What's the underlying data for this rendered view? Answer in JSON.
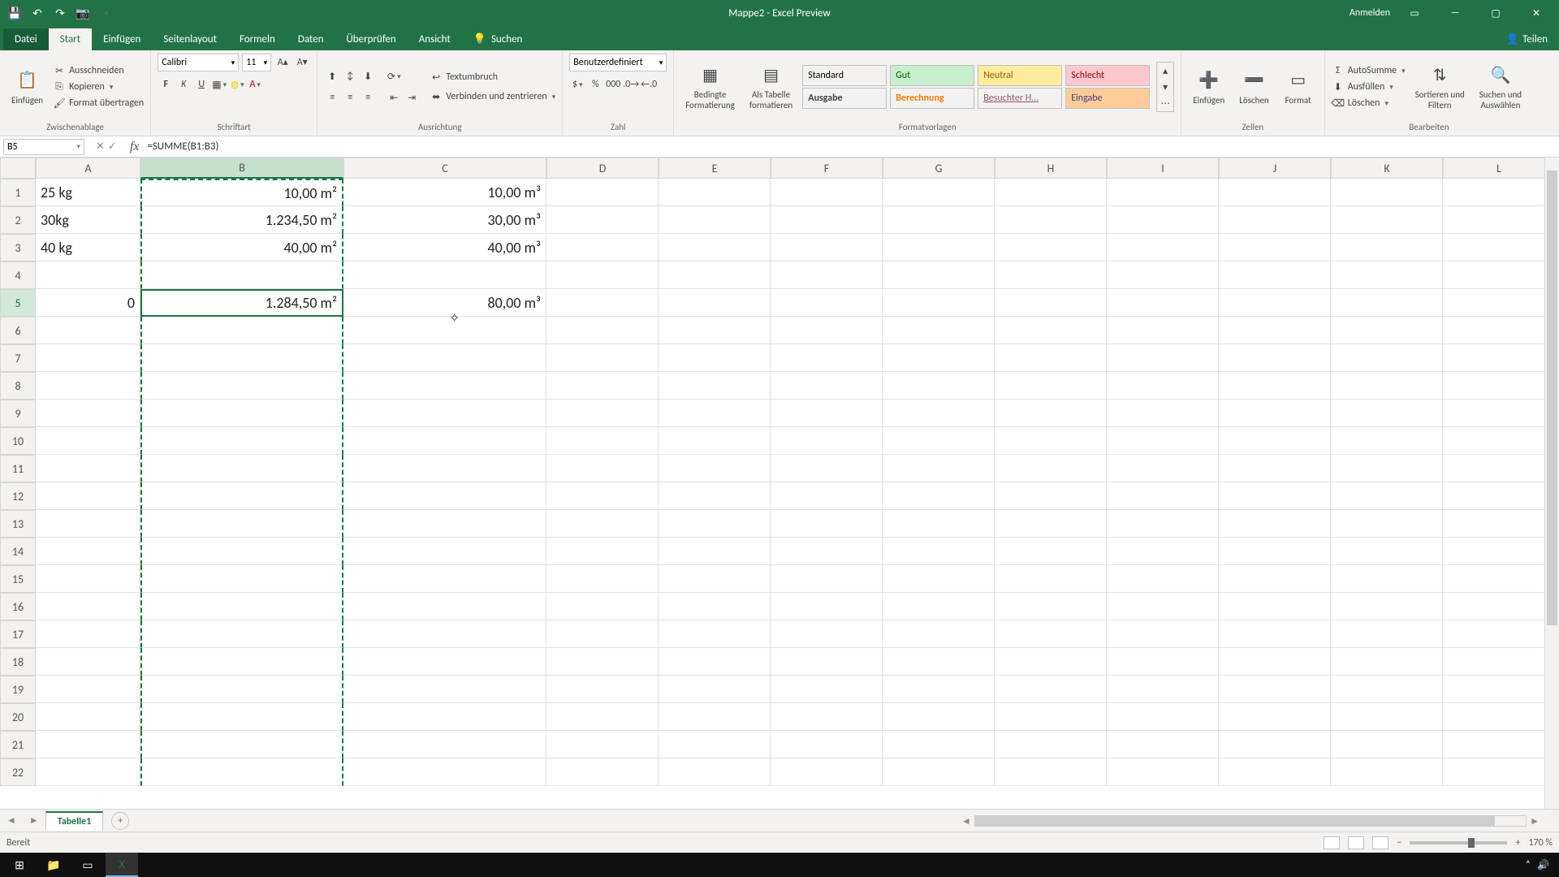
{
  "titlebar": {
    "title": "Mappe2  -  Excel Preview",
    "signin": "Anmelden"
  },
  "tabs": {
    "file": "Datei",
    "home": "Start",
    "insert": "Einfügen",
    "layout": "Seitenlayout",
    "formulas": "Formeln",
    "data": "Daten",
    "review": "Überprüfen",
    "view": "Ansicht",
    "tellme": "Suchen",
    "share": "Teilen"
  },
  "clipboard": {
    "paste": "Einfügen",
    "cut": "Ausschneiden",
    "copy": "Kopieren",
    "painter": "Format übertragen",
    "label": "Zwischenablage"
  },
  "font": {
    "name": "Calibri",
    "size": "11",
    "label": "Schriftart"
  },
  "alignment": {
    "wrap": "Textumbruch",
    "merge": "Verbinden und zentrieren",
    "label": "Ausrichtung"
  },
  "number": {
    "format": "Benutzerdefiniert",
    "label": "Zahl"
  },
  "styles": {
    "cond": "Bedingte\nFormatierung",
    "table": "Als Tabelle\nformatieren",
    "s1": "Standard",
    "s2": "Gut",
    "s3": "Neutral",
    "s4": "Schlecht",
    "s5": "Ausgabe",
    "s6": "Berechnung",
    "s7": "Besuchter H...",
    "s8": "Eingabe",
    "label": "Formatvorlagen"
  },
  "cells": {
    "insert": "Einfügen",
    "delete": "Löschen",
    "format": "Format",
    "label": "Zellen"
  },
  "editing": {
    "autosum": "AutoSumme",
    "fill": "Ausfüllen",
    "clear": "Löschen",
    "sort": "Sortieren und\nFiltern",
    "find": "Suchen und\nAuswählen",
    "label": "Bearbeiten"
  },
  "namebox": "B5",
  "formula": "=SUMME(B1:B3)",
  "columns": [
    "A",
    "B",
    "C",
    "D",
    "E",
    "F",
    "G",
    "H",
    "I",
    "J",
    "K",
    "L"
  ],
  "rows": [
    "1",
    "2",
    "3",
    "4",
    "5",
    "6",
    "7",
    "8",
    "9",
    "10",
    "11",
    "12",
    "13",
    "14",
    "15",
    "16",
    "17",
    "18",
    "19",
    "20",
    "21",
    "22"
  ],
  "cells_data": {
    "A1": "25 kg",
    "B1": "10,00 m²",
    "C1": "10,00 m³",
    "A2": "30kg",
    "B2": "1.234,50 m²",
    "C2": "30,00 m³",
    "A3": "40 kg",
    "B3": "40,00 m²",
    "C3": "40,00 m³",
    "A5": "0",
    "B5": "1.284,50 m²",
    "C5": "80,00 m³"
  },
  "sheet_tab": "Tabelle1",
  "status": "Bereit",
  "zoom": "170 %"
}
